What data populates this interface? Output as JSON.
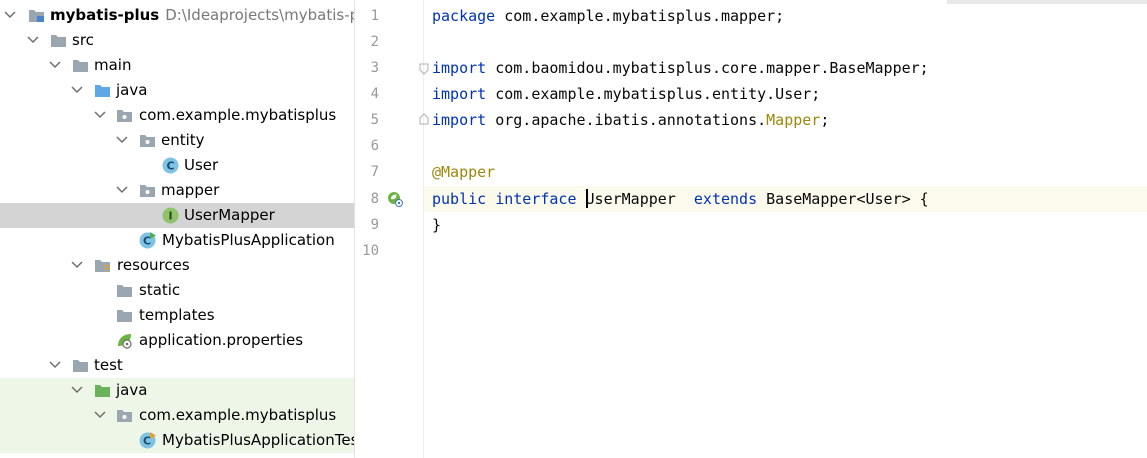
{
  "project_tree": {
    "root": {
      "name": "mybatis-plus",
      "path": "D:\\Ideaprojects\\mybatis-plu"
    },
    "items": [
      {
        "label": "src"
      },
      {
        "label": "main"
      },
      {
        "label": "java"
      },
      {
        "label": "com.example.mybatisplus"
      },
      {
        "label": "entity"
      },
      {
        "label": "User"
      },
      {
        "label": "mapper"
      },
      {
        "label": "UserMapper"
      },
      {
        "label": "MybatisPlusApplication"
      },
      {
        "label": "resources"
      },
      {
        "label": "static"
      },
      {
        "label": "templates"
      },
      {
        "label": "application.properties"
      },
      {
        "label": "test"
      },
      {
        "label": "java"
      },
      {
        "label": "com.example.mybatisplus"
      },
      {
        "label": "MybatisPlusApplicationTes"
      }
    ]
  },
  "editor": {
    "line_numbers": [
      "1",
      "2",
      "3",
      "4",
      "5",
      "6",
      "7",
      "8",
      "9",
      "10"
    ],
    "code": {
      "l1": {
        "kw": "package",
        "rest": " com.example.mybatisplus.mapper;"
      },
      "l3": {
        "kw": "import",
        "rest": " com.baomidou.mybatisplus.core.mapper.BaseMapper;"
      },
      "l4": {
        "kw": "import",
        "rest": " com.example.mybatisplus.entity.User;"
      },
      "l5": {
        "kw": "import",
        "rest": " org.apache.ibatis.annotations.",
        "ann": "Mapper",
        "end": ";"
      },
      "l7": {
        "ann": "@Mapper"
      },
      "l8": {
        "kw1": "public",
        "kw2": "interface",
        "name": "UserMapper",
        "kw3": "extends",
        "rest": " BaseMapper<User> {"
      },
      "l9": {
        "text": "}"
      }
    }
  }
}
